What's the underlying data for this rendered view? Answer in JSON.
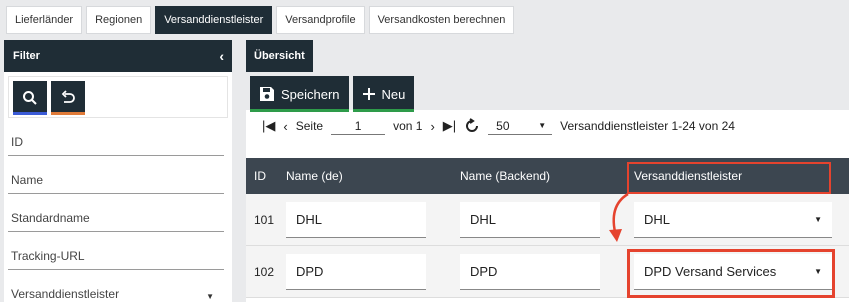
{
  "tabs": [
    "Lieferländer",
    "Regionen",
    "Versanddienstleister",
    "Versandprofile",
    "Versandkosten berechnen"
  ],
  "active_tab": "Versanddienstleister",
  "filter": {
    "title": "Filter",
    "collapse_icon": "‹",
    "fields": [
      "ID",
      "Name",
      "Standardname",
      "Tracking-URL",
      "Versanddienstleister"
    ]
  },
  "overview": {
    "tab": "Übersicht",
    "save_label": "Speichern",
    "new_label": "Neu"
  },
  "pager": {
    "page_label": "Seite",
    "page": "1",
    "of_label": "von 1",
    "per_page": "50",
    "summary": "Versanddienstleister 1-24 von 24"
  },
  "table": {
    "headers": [
      "ID",
      "Name (de)",
      "Name (Backend)",
      "Versanddienstleister"
    ],
    "rows": [
      {
        "id": "101",
        "name_de": "DHL",
        "name_backend": "DHL",
        "carrier": "DHL"
      },
      {
        "id": "102",
        "name_de": "DPD",
        "name_backend": "DPD",
        "carrier": "DPD Versand Services"
      }
    ]
  },
  "colors": {
    "dark": "#1f2d36",
    "grid_header": "#3c4650",
    "save_accent": "#2e9b4a",
    "search_accent": "#3b5bd6",
    "reset_accent": "#e07b39",
    "highlight": "#e5432e"
  },
  "icons": [
    "search-icon",
    "reset-icon",
    "save-icon",
    "plus-icon",
    "first-page-icon",
    "prev-page-icon",
    "next-page-icon",
    "last-page-icon",
    "refresh-icon",
    "dropdown-icon"
  ]
}
